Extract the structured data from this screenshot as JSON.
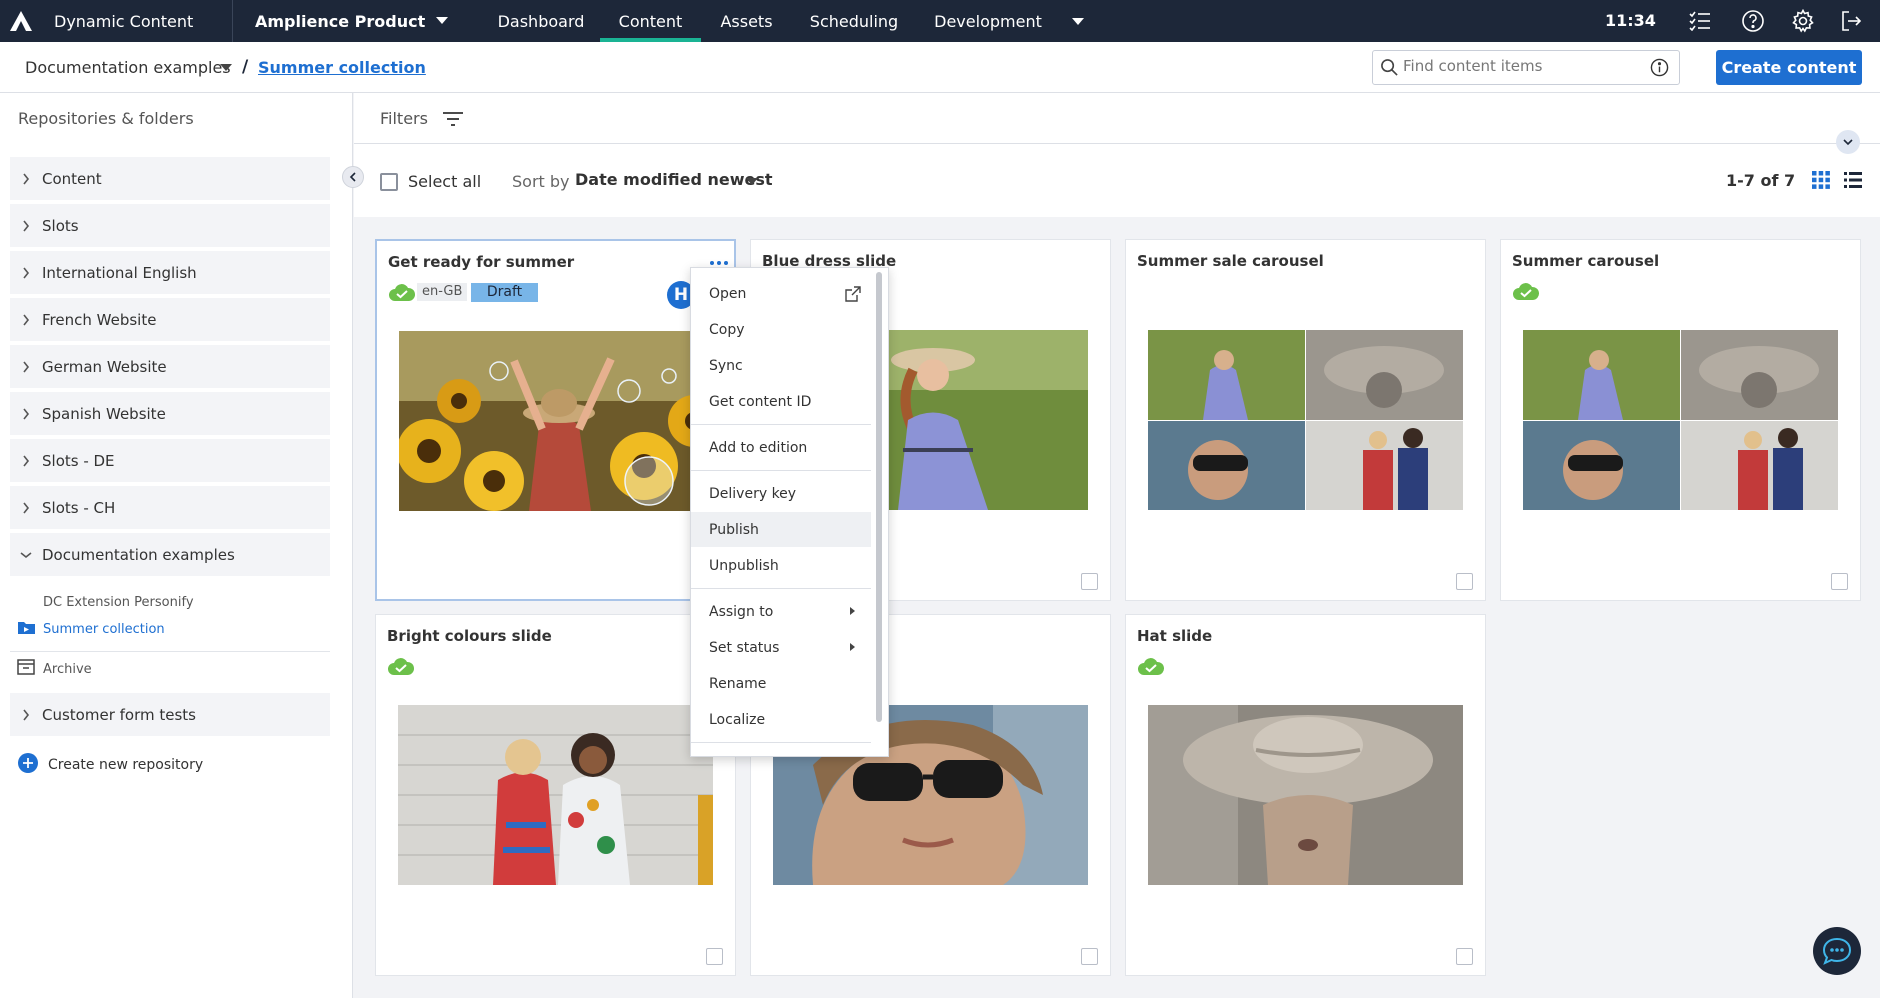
{
  "app": {
    "name": "Dynamic Content",
    "hub": "Amplience Product",
    "nav": [
      "Dashboard",
      "Content",
      "Assets",
      "Scheduling",
      "Development"
    ],
    "active_nav": "Content",
    "time": "11:34"
  },
  "breadcrumb": {
    "repo": "Documentation examples",
    "separator": "/",
    "folder": "Summer collection"
  },
  "search": {
    "placeholder": "Find content items"
  },
  "create_button": "Create content",
  "sidebar": {
    "title": "Repositories & folders",
    "items": [
      "Content",
      "Slots",
      "International English",
      "French Website",
      "German Website",
      "Spanish Website",
      "Slots - DE",
      "Slots - CH",
      "Documentation examples"
    ],
    "sub_folder": "DC Extension Personify",
    "selected_folder": "Summer collection",
    "archive": "Archive",
    "extra_item": "Customer form tests",
    "create_repo": "Create new repository"
  },
  "filters_label": "Filters",
  "toolbar": {
    "select_all": "Select all",
    "sort_by": "Sort by",
    "sort_value": "Date modified newest",
    "count": "1-7 of 7"
  },
  "cards": [
    {
      "title": "Get ready for summer",
      "locale": "en-GB",
      "status": "Draft",
      "avatar": "H"
    },
    {
      "title": "Blue dress slide"
    },
    {
      "title": "Summer sale carousel"
    },
    {
      "title": "Summer carousel"
    },
    {
      "title": "Bright colours slide"
    },
    {
      "title": ""
    },
    {
      "title": "Hat slide"
    }
  ],
  "context_menu": {
    "items": [
      "Open",
      "Copy",
      "Sync",
      "Get content ID",
      "Add to edition",
      "Delivery key",
      "Publish",
      "Unpublish",
      "Assign to",
      "Set status",
      "Rename",
      "Localize"
    ],
    "hovered": "Publish"
  },
  "colors": {
    "topbar": "#1d2739",
    "accent": "#1e6fd1",
    "active_tab": "#1ab394",
    "published": "#6cc04a"
  },
  "icons": [
    "amplience-logo-icon",
    "tasks-icon",
    "help-icon",
    "settings-icon",
    "logout-icon",
    "search-icon",
    "info-icon",
    "filter-icon",
    "grid-view-icon",
    "list-view-icon",
    "cloud-check-icon",
    "chat-icon"
  ]
}
